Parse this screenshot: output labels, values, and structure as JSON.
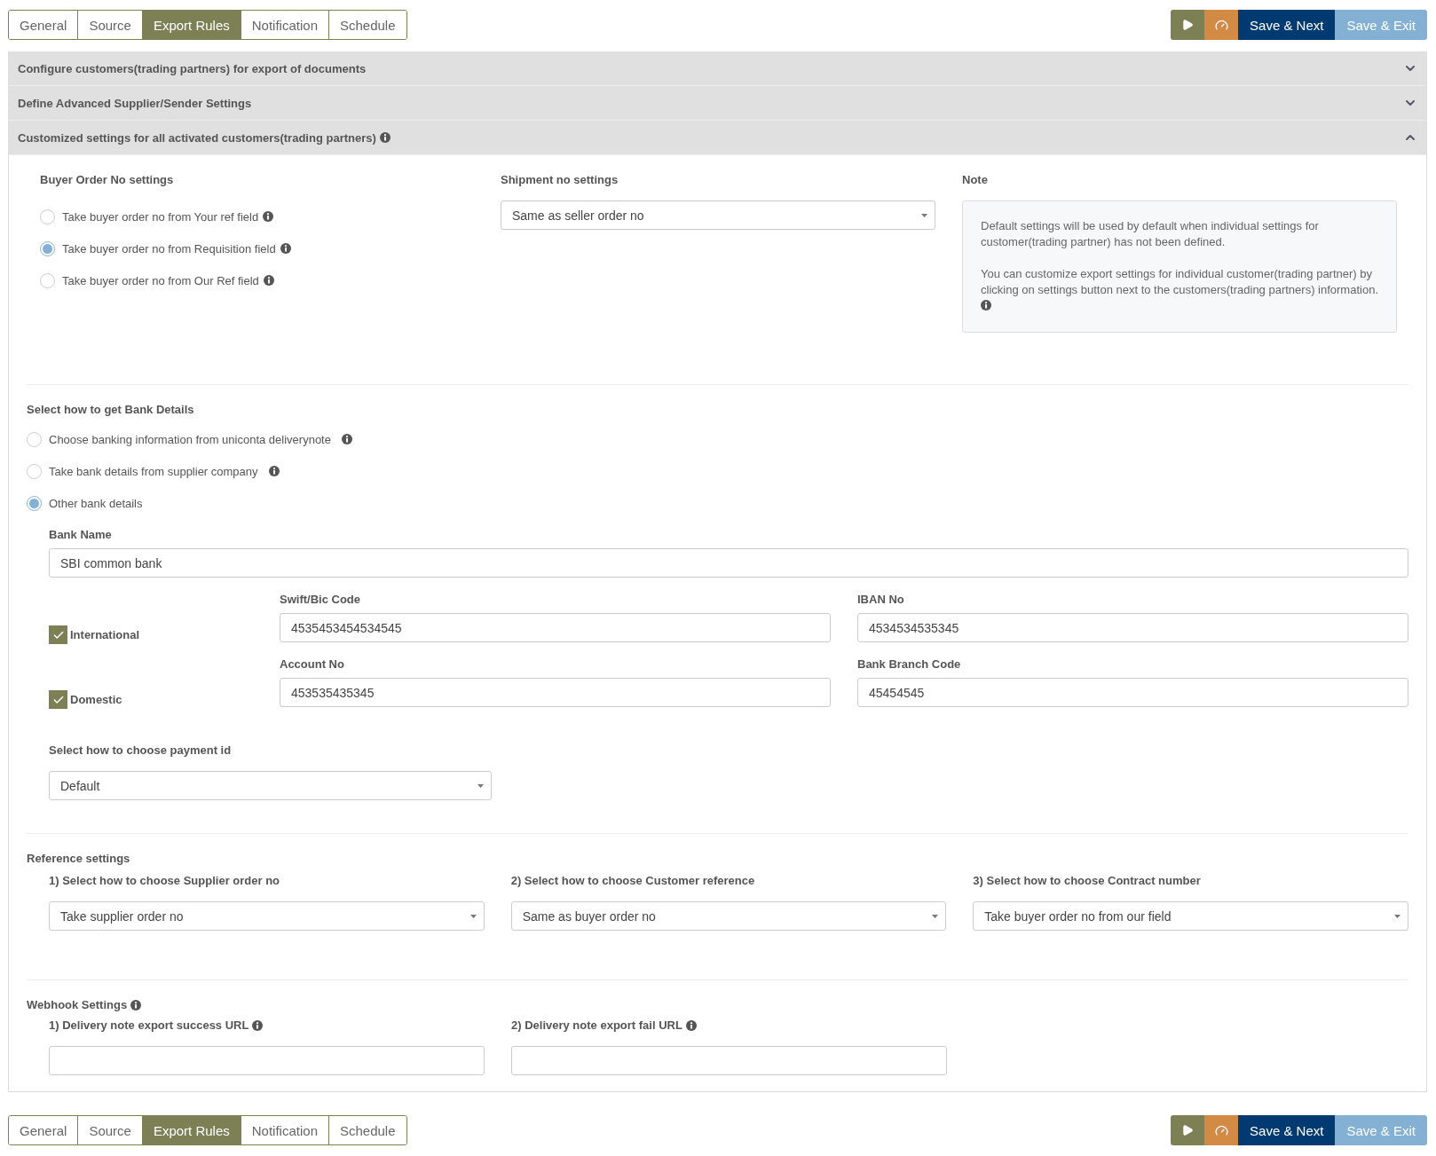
{
  "toolbars": [
    {
      "tabs": [
        {
          "label": "General",
          "selected": false
        },
        {
          "label": "Source",
          "selected": false
        },
        {
          "label": "Export Rules",
          "selected": true
        },
        {
          "label": "Notification",
          "selected": false
        },
        {
          "label": "Schedule",
          "selected": false
        }
      ],
      "actions": [
        {
          "kind": "play"
        },
        {
          "kind": "gauge"
        },
        {
          "kind": "primary",
          "label": "Save & Next"
        },
        {
          "kind": "secondary",
          "label": "Save & Exit"
        }
      ]
    },
    {
      "tabs": [
        {
          "label": "General",
          "selected": false
        },
        {
          "label": "Source",
          "selected": false
        },
        {
          "label": "Export Rules",
          "selected": true
        },
        {
          "label": "Notification",
          "selected": false
        },
        {
          "label": "Schedule",
          "selected": false
        }
      ],
      "actions": [
        {
          "kind": "play"
        },
        {
          "kind": "gauge"
        },
        {
          "kind": "primary",
          "label": "Save & Next"
        },
        {
          "kind": "secondary",
          "label": "Save & Exit"
        }
      ]
    }
  ],
  "accordion": [
    {
      "title": "Configure customers(trading partners) for export of documents",
      "info": false,
      "expanded": false
    },
    {
      "title": "Define Advanced Supplier/Sender Settings",
      "info": false,
      "expanded": false
    },
    {
      "title": "Customized settings for all activated customers(trading partners)",
      "info": true,
      "expanded": true
    }
  ],
  "buyer_order": {
    "heading": "Buyer Order No settings",
    "options": [
      {
        "label": "Take buyer order no from Your ref field",
        "selected": false
      },
      {
        "label": "Take buyer order no from Requisition field",
        "selected": true
      },
      {
        "label": "Take buyer order no from Our Ref field",
        "selected": false
      }
    ]
  },
  "shipment": {
    "heading": "Shipment no settings",
    "value": "Same as seller order no"
  },
  "note": {
    "heading": "Note",
    "paragraphs": [
      "Default settings will be used by default when individual settings for customer(trading partner) has not been defined.",
      "You can customize export settings for individual customer(trading partner) by clicking on settings button next to the customers(trading partners) information."
    ]
  },
  "bank_details": {
    "heading": "Select how to get Bank Details",
    "options": [
      {
        "label": "Choose banking information from uniconta deliverynote",
        "selected": false,
        "info": true
      },
      {
        "label": "Take bank details from supplier company",
        "selected": false,
        "info": true
      },
      {
        "label": "Other bank details",
        "selected": true,
        "info": false
      }
    ],
    "bank_name": {
      "label": "Bank Name",
      "value": "SBI common bank"
    },
    "rows": [
      {
        "label": "International",
        "checked": true,
        "fields": [
          {
            "label": "Swift/Bic Code",
            "value": "4535453454534545"
          },
          {
            "label": "IBAN No",
            "value": "4534534535345"
          }
        ]
      },
      {
        "label": "Domestic",
        "checked": true,
        "fields": [
          {
            "label": "Account No",
            "value": "453535435345"
          },
          {
            "label": "Bank Branch Code",
            "value": "45454545"
          }
        ]
      }
    ],
    "payment_id": {
      "label": "Select how to choose payment id",
      "value": "Default"
    }
  },
  "reference": {
    "heading": "Reference settings",
    "items": [
      {
        "label": "1) Select how to choose Supplier order no",
        "value": "Take supplier order no"
      },
      {
        "label": "2) Select how to choose Customer reference",
        "value": "Same as buyer order no"
      },
      {
        "label": "3) Select how to choose Contract number",
        "value": "Take buyer order no from our field"
      }
    ]
  },
  "webhook": {
    "heading": "Webhook Settings",
    "items": [
      {
        "label": "1) Delivery note export success URL"
      },
      {
        "label": "2) Delivery note export fail URL"
      }
    ]
  }
}
